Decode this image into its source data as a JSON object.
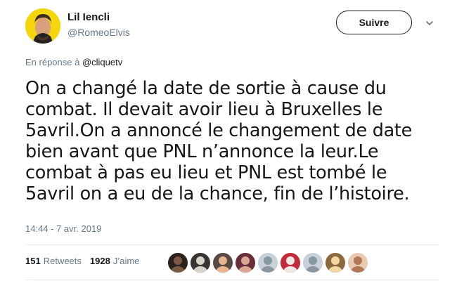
{
  "author": {
    "name": "Lil Iencli",
    "handle": "@RomeoElvis",
    "avatar_bg": "#f5d60c"
  },
  "follow_button": {
    "label": "Suivre"
  },
  "menu": {
    "icon": "chevron-down-icon"
  },
  "reply": {
    "prefix": "En réponse à ",
    "mention": "@cliquetv"
  },
  "tweet": {
    "lines": [
      "On a changé la date de sortie à cause du",
      "combat. Il devait avoir lieu à Bruxelles le",
      "5avril.On a annoncé le changement de date",
      "bien avant que PNL n’annonce la leur.Le",
      "combat à pas eu lieu et PNL est tombé le",
      "5avril on a eu de la chance, fin de l’histoire."
    ],
    "timestamp": "14:44 - 7 avr. 2019"
  },
  "stats": {
    "retweets_count": "151",
    "retweets_label": "Retweets",
    "likes_count": "1928",
    "likes_label": "J’aime"
  },
  "likers": [
    {
      "bg": "#2b2220",
      "fg": "#7a5a44"
    },
    {
      "bg": "#3a3535",
      "fg": "#d9d2c8"
    },
    {
      "bg": "#5a4a45",
      "fg": "#e8b48c"
    },
    {
      "bg": "#6a2e3a",
      "fg": "#d8a892"
    },
    {
      "bg": "#c9d1d8",
      "fg": "#8a98a4"
    },
    {
      "bg": "#c42b3a",
      "fg": "#f0e8e2"
    },
    {
      "bg": "#c9d1d8",
      "fg": "#8a98a4"
    },
    {
      "bg": "#8b6a3e",
      "fg": "#f3d6a4"
    },
    {
      "bg": "#e9c9b0",
      "fg": "#b07858"
    }
  ]
}
